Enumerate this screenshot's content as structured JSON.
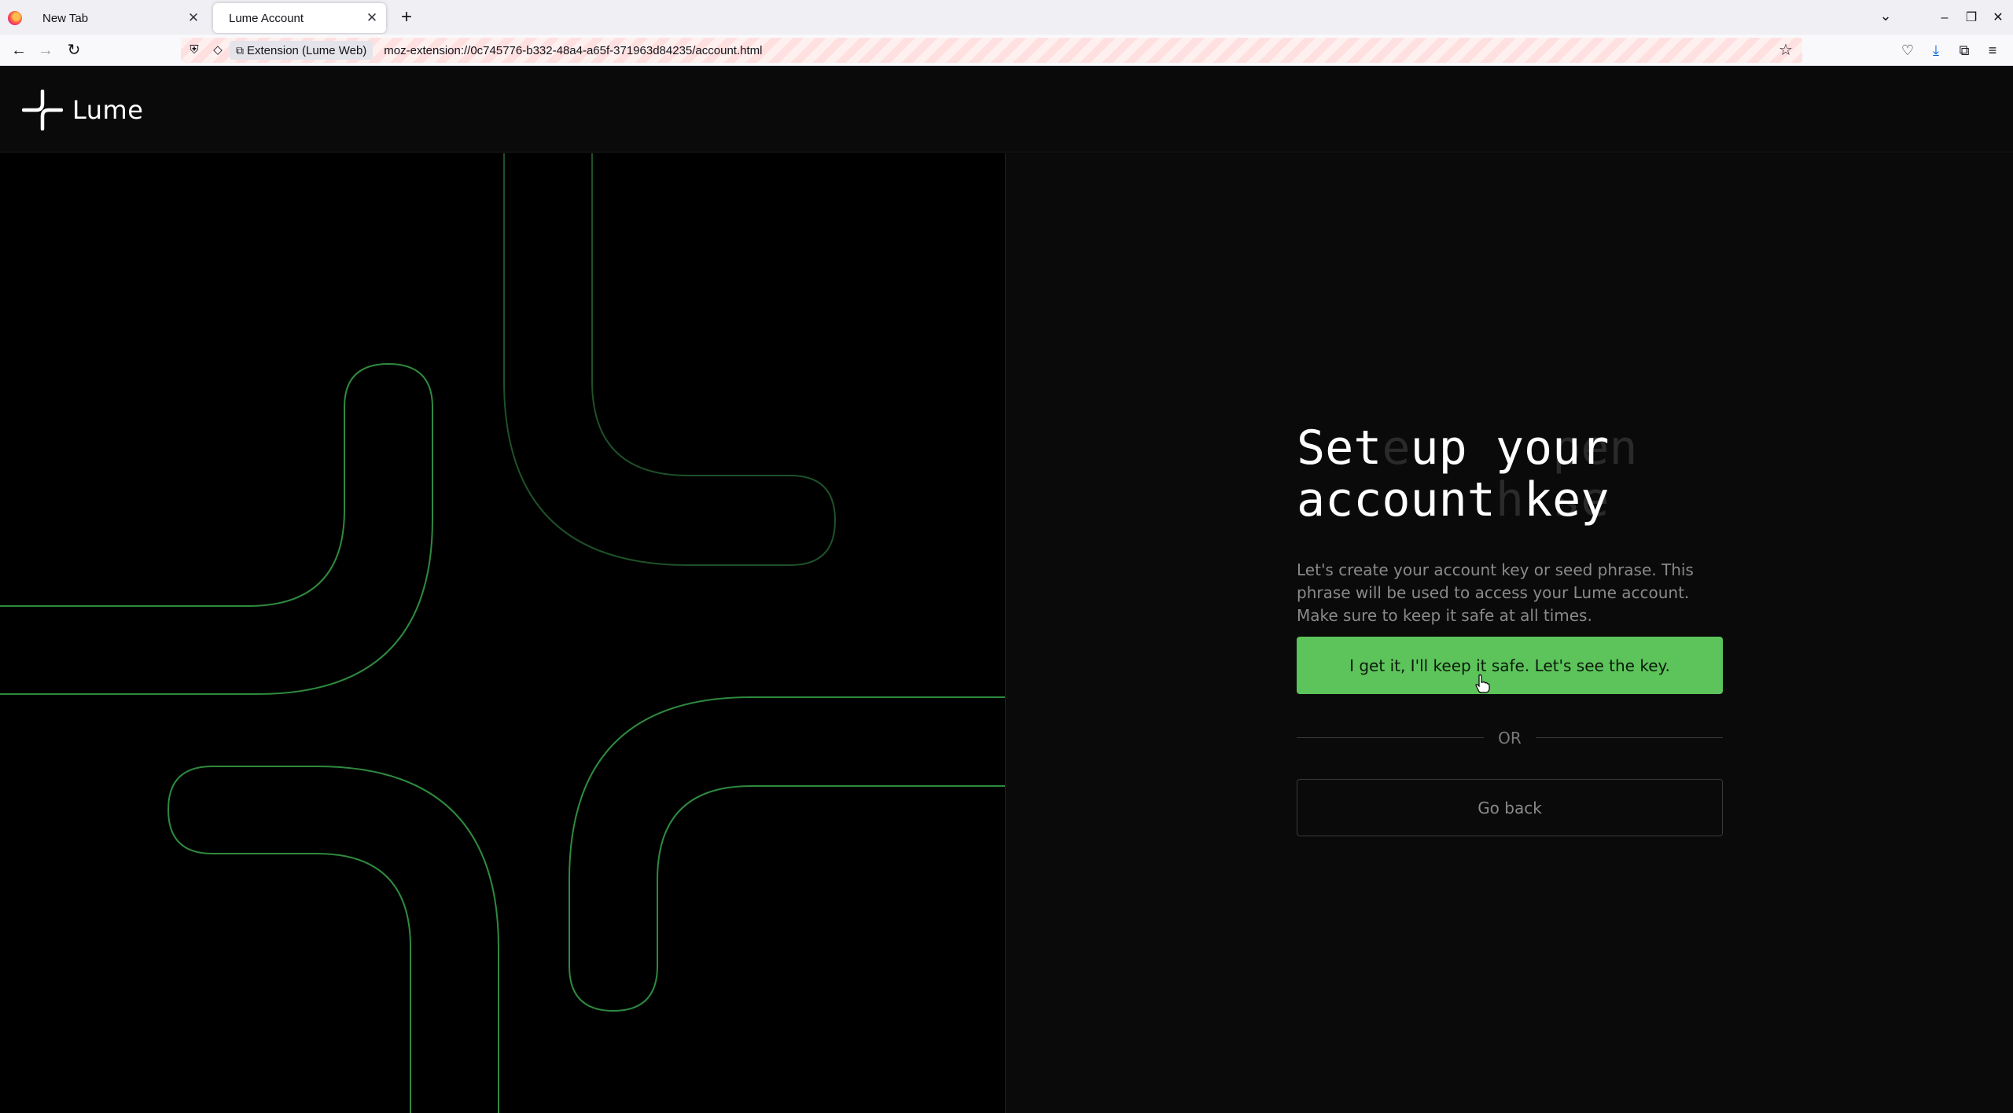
{
  "browser": {
    "tabs": [
      {
        "title": "New Tab",
        "active": false
      },
      {
        "title": "Lume Account",
        "active": true
      }
    ],
    "url_identity_label": "Extension (Lume Web)",
    "url": "moz-extension://0c745776-b332-48a4-a65f-371963d84235/account.html",
    "icons": {
      "back": "back-arrow-icon",
      "forward": "forward-arrow-icon",
      "reload": "reload-icon",
      "bookmark": "star-icon",
      "pocket": "pocket-icon",
      "downloads": "download-icon",
      "extensions": "puzzle-icon",
      "menu": "hamburger-menu-icon"
    }
  },
  "app": {
    "brand_name": "Lume",
    "heading_lines": [
      "Set up your",
      "account key"
    ],
    "heading_ghost_lines": [
      "   e    open",
      "       h se"
    ],
    "description": "Let's create your account key or seed phrase. This phrase will be used to access your Lume account. Make sure to keep it safe at all times.",
    "primary_button": "I get it, I'll keep it safe. Let's see the key.",
    "separator_text": "OR",
    "secondary_button": "Go back"
  },
  "colors": {
    "accent_green": "#5cc45a",
    "line_green": "#2e8a3e",
    "background": "#0a0a0a"
  }
}
